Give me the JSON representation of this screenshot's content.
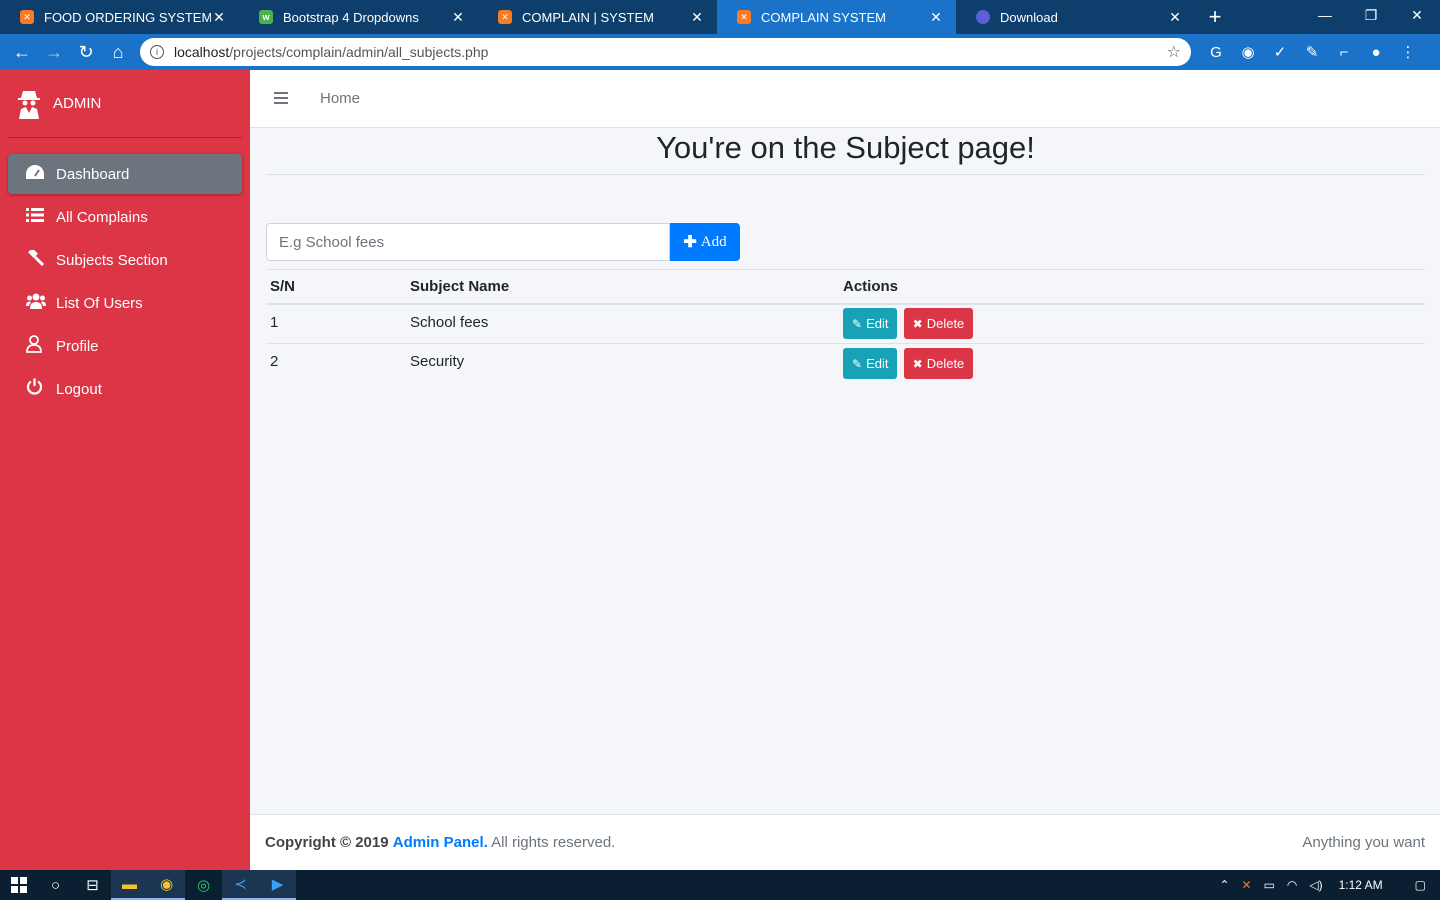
{
  "browser": {
    "tabs": [
      {
        "title": "FOOD ORDERING SYSTEM",
        "icon": "xampp-icon",
        "active": false
      },
      {
        "title": "Bootstrap 4 Dropdowns",
        "icon": "w3-icon",
        "active": false
      },
      {
        "title": "COMPLAIN | SYSTEM",
        "icon": "xampp-icon",
        "active": false
      },
      {
        "title": "COMPLAIN SYSTEM",
        "icon": "xampp-icon",
        "active": true
      },
      {
        "title": "Download",
        "icon": "globe-icon",
        "active": false
      }
    ],
    "url_host": "localhost",
    "url_path": "/projects/complain/admin/all_subjects.php"
  },
  "sidebar": {
    "brand": "ADMIN",
    "items": [
      {
        "label": "Dashboard",
        "icon": "tachometer-icon",
        "active": true
      },
      {
        "label": "All Complains",
        "icon": "list-icon",
        "active": false
      },
      {
        "label": "Subjects Section",
        "icon": "gavel-icon",
        "active": false
      },
      {
        "label": "List Of Users",
        "icon": "users-icon",
        "active": false
      },
      {
        "label": "Profile",
        "icon": "user-icon",
        "active": false
      },
      {
        "label": "Logout",
        "icon": "power-icon",
        "active": false
      }
    ]
  },
  "topnav": {
    "home": "Home"
  },
  "page": {
    "title": "You're on the Subject page!",
    "input_placeholder": "E.g School fees",
    "add_label": "Add"
  },
  "table": {
    "headers": [
      "S/N",
      "Subject Name",
      "Actions"
    ],
    "rows": [
      {
        "sn": "1",
        "name": "School fees"
      },
      {
        "sn": "2",
        "name": "Security"
      }
    ],
    "edit_label": "Edit",
    "delete_label": "Delete"
  },
  "footer": {
    "copyright": "Copyright © 2019",
    "brand": "Admin Panel.",
    "rights": "All rights reserved.",
    "right_text": "Anything you want"
  },
  "taskbar": {
    "time": "1:12 AM"
  },
  "colors": {
    "sidebar": "#dc3545",
    "active_nav": "#6c757d",
    "primary": "#007bff",
    "info": "#17a2b8",
    "danger": "#dc3545",
    "chrome_active_tab": "#1a73c9"
  }
}
